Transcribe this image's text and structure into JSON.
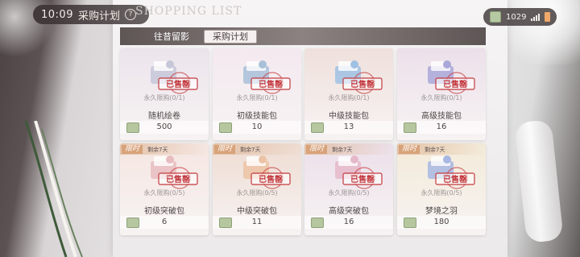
{
  "status": {
    "time": "10:09",
    "title": "采购计划",
    "help_icon": "question-icon",
    "shopping_title": "SHOPPING LIST",
    "currency_amount": "1029"
  },
  "tabs": [
    {
      "label": "往昔留影",
      "active": false
    },
    {
      "label": "采购计划",
      "active": true
    }
  ],
  "sold_stamp": "已售罄",
  "items": [
    {
      "name": "随机绘卷",
      "limit": "永久限购(0/1)",
      "price": "500",
      "timed": false,
      "bg": "#ece4ec",
      "art_color": "#c6c7d8"
    },
    {
      "name": "初级技能包",
      "limit": "永久限购(0/1)",
      "price": "10",
      "timed": false,
      "bg": "#f3e9ef",
      "art_color": "#a8c0d8"
    },
    {
      "name": "中级技能包",
      "limit": "永久限购(0/1)",
      "price": "13",
      "timed": false,
      "bg": "#efe0dc",
      "art_color": "#9fc1e3"
    },
    {
      "name": "高级技能包",
      "limit": "永久限购(0/1)",
      "price": "16",
      "timed": false,
      "bg": "#ece0ea",
      "art_color": "#a9a8d8"
    },
    {
      "name": "初级突破包",
      "limit": "永久限购(0/5)",
      "price": "6",
      "timed": true,
      "timer_tag": "限时",
      "timer_text": "剩余7天",
      "bg": "#f5e6e2",
      "art_color": "#e8bdc0"
    },
    {
      "name": "中级突破包",
      "limit": "永久限购(0/5)",
      "price": "11",
      "timed": true,
      "timer_tag": "限时",
      "timer_text": "剩余7天",
      "bg": "#eedcd2",
      "art_color": "#ecc3a4"
    },
    {
      "name": "高级突破包",
      "limit": "永久限购(0/5)",
      "price": "16",
      "timed": true,
      "timer_tag": "限时",
      "timer_text": "剩余7天",
      "bg": "#ecdfea",
      "art_color": "#e5b8c9"
    },
    {
      "name": "梦境之羽",
      "limit": "永久限购(0/5)",
      "price": "180",
      "timed": true,
      "timer_tag": "限时",
      "timer_text": "剩余7天",
      "bg": "#f3ead8",
      "art_color": "#a7b7e2"
    }
  ],
  "colors": {
    "stamp_red": "#c33a3f",
    "tab_bar": "#7d7373",
    "currency_green": "#b6c79f"
  }
}
